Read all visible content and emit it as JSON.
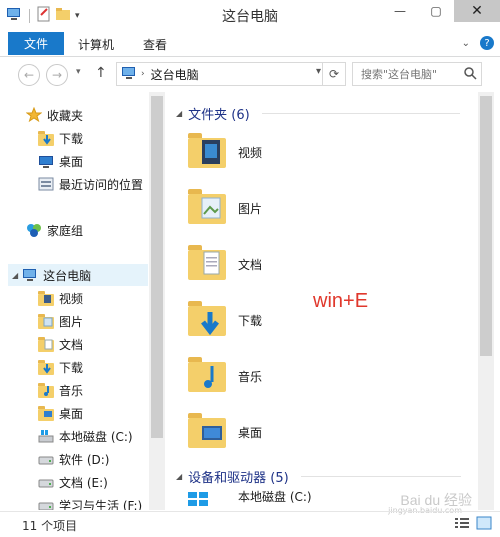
{
  "window": {
    "title": "这台电脑"
  },
  "ribbon": {
    "tab_file": "文件",
    "tab_computer": "计算机",
    "tab_view": "查看"
  },
  "navbar": {
    "address": "这台电脑",
    "search_placeholder": "搜索\"这台电脑\""
  },
  "sidebar": {
    "favorites_header": "收藏夹",
    "favorites": [
      "下载",
      "桌面",
      "最近访问的位置"
    ],
    "homegroup": "家庭组",
    "thispc_header": "这台电脑",
    "thispc_items": [
      "视频",
      "图片",
      "文档",
      "下载",
      "音乐",
      "桌面",
      "本地磁盘 (C:)",
      "软件 (D:)",
      "文档 (E:)",
      "学习与生活 (F:)"
    ]
  },
  "content": {
    "folders_header": "文件夹 (6)",
    "folders": [
      "视频",
      "图片",
      "文档",
      "下载",
      "音乐",
      "桌面"
    ],
    "devices_header": "设备和驱动器 (5)",
    "devices": [
      "本地磁盘 (C:)"
    ]
  },
  "annotation": "win+E",
  "status": {
    "item_count": "11 个项目"
  },
  "watermark": {
    "main": "Bai du 经验",
    "url": "jingyan.baidu.com"
  },
  "colors": {
    "accent": "#1979ca",
    "group_header": "#1e3287",
    "annotation": "#e0382c"
  }
}
